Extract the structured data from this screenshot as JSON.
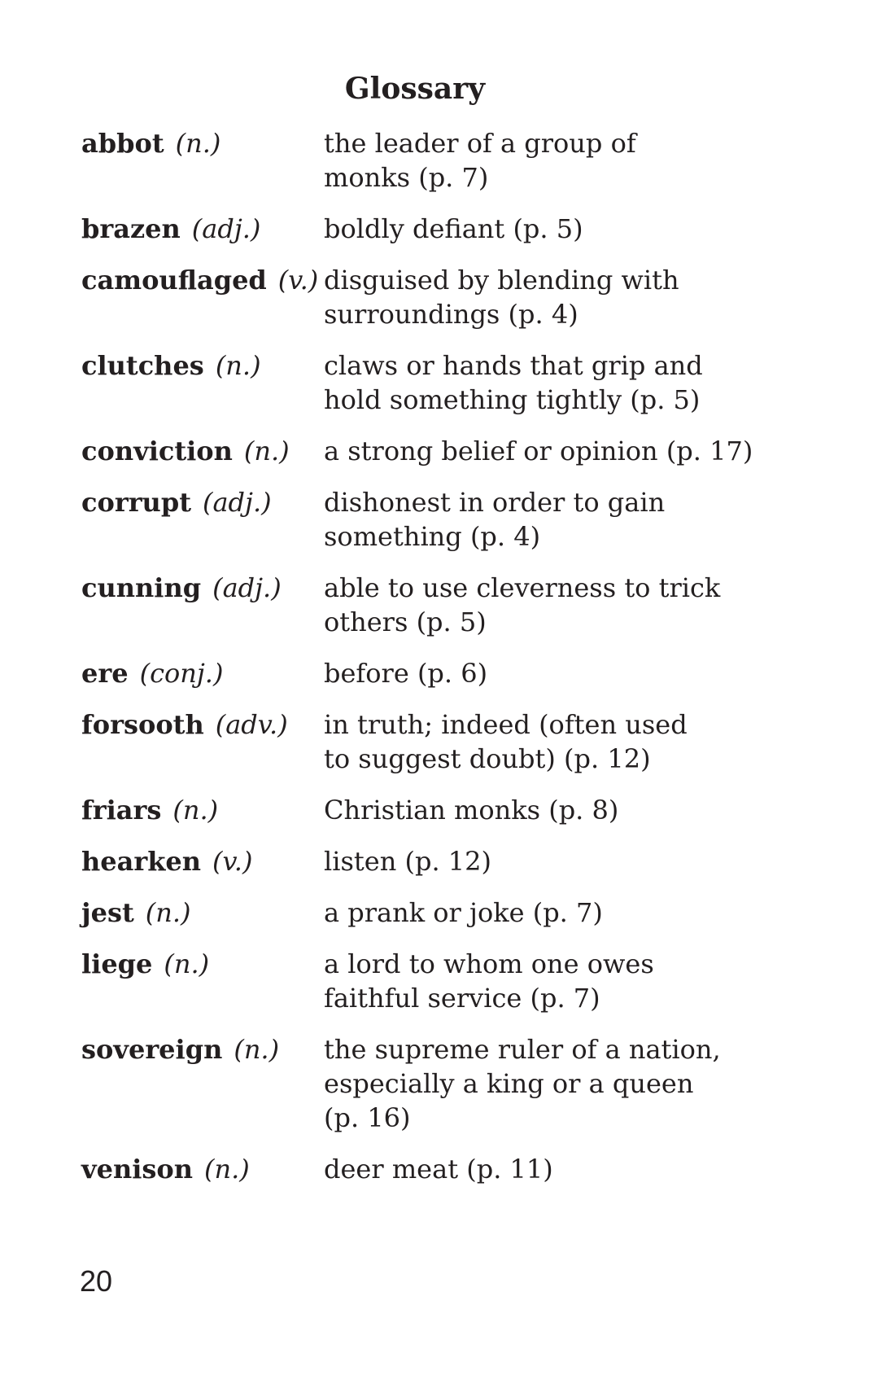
{
  "page": {
    "title": "Glossary",
    "page_number": "20"
  },
  "entries": [
    {
      "term": "abbot",
      "pos": "(n.)",
      "definition": "the leader of a group of\nmonks (p. 7)"
    },
    {
      "term": "brazen",
      "pos": "(adj.)",
      "definition": "boldly defiant (p. 5)"
    },
    {
      "term": "camouflaged",
      "pos": "(v.)",
      "definition": "disguised by blending with\nsurroundings (p. 4)"
    },
    {
      "term": "clutches",
      "pos": "(n.)",
      "definition": "claws or hands that grip and\nhold something tightly (p. 5)"
    },
    {
      "term": "conviction",
      "pos": "(n.)",
      "definition": "a strong belief or opinion (p. 17)"
    },
    {
      "term": "corrupt",
      "pos": "(adj.)",
      "definition": "dishonest in order to gain\nsomething (p. 4)"
    },
    {
      "term": "cunning",
      "pos": "(adj.)",
      "definition": "able to use cleverness to trick\nothers (p. 5)"
    },
    {
      "term": "ere",
      "pos": "(conj.)",
      "definition": "before (p. 6)"
    },
    {
      "term": "forsooth",
      "pos": "(adv.)",
      "definition": "in truth; indeed (often used\nto suggest doubt) (p. 12)"
    },
    {
      "term": "friars",
      "pos": "(n.)",
      "definition": "Christian monks (p. 8)"
    },
    {
      "term": "hearken",
      "pos": "(v.)",
      "definition": "listen (p. 12)"
    },
    {
      "term": "jest",
      "pos": "(n.)",
      "definition": "a prank or joke (p. 7)"
    },
    {
      "term": "liege",
      "pos": "(n.)",
      "definition": "a lord to whom one owes\nfaithful service (p. 7)"
    },
    {
      "term": "sovereign",
      "pos": "(n.)",
      "definition": "the supreme ruler of a nation,\nespecially a king or a queen\n(p. 16)"
    },
    {
      "term": "venison",
      "pos": "(n.)",
      "definition": "deer meat (p. 11)"
    }
  ]
}
